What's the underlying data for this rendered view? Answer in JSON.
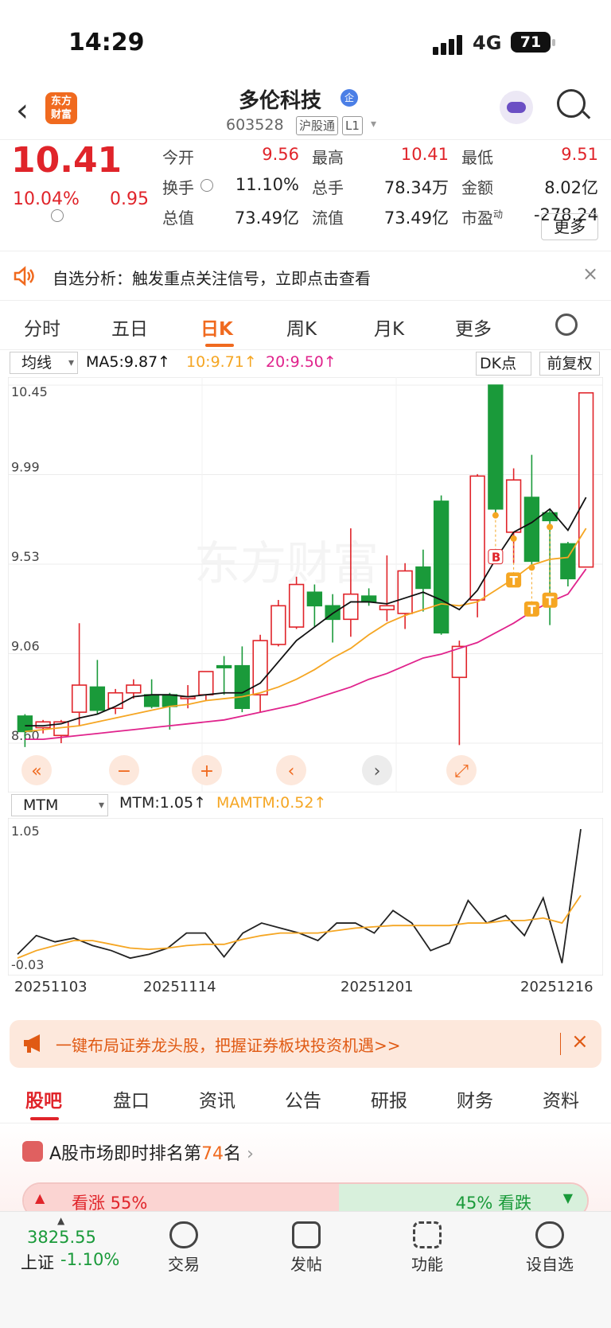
{
  "status_bar": {
    "time": "14:29",
    "network": "4G",
    "battery": "71"
  },
  "header": {
    "logo_line1": "东方",
    "logo_line2": "财富",
    "stock_name": "多伦科技",
    "badge": "企",
    "stock_code": "603528",
    "tag_connect": "沪股通",
    "tag_level": "L1"
  },
  "quote": {
    "price": "10.41",
    "change_pct": "10.04%",
    "change": "0.95",
    "fields": [
      {
        "label": "今开",
        "value": "9.56",
        "color": "red"
      },
      {
        "label": "最高",
        "value": "10.41",
        "color": "red"
      },
      {
        "label": "最低",
        "value": "9.51",
        "color": "red"
      },
      {
        "label": "换手",
        "value": "11.10%",
        "color": "black"
      },
      {
        "label": "总手",
        "value": "78.34万",
        "color": "black"
      },
      {
        "label": "金额",
        "value": "8.02亿",
        "color": "black"
      },
      {
        "label": "总值",
        "value": "73.49亿",
        "color": "black"
      },
      {
        "label": "流值",
        "value": "73.49亿",
        "color": "black"
      },
      {
        "label": "市盈",
        "label_sup": "动",
        "value": "-278.24",
        "color": "black"
      }
    ],
    "more_label": "更多"
  },
  "alert": {
    "text": "自选分析：触发重点关注信号，立即点击查看",
    "close": "×"
  },
  "kline_tabs": {
    "tabs": [
      "分时",
      "五日",
      "日K",
      "周K",
      "月K",
      "更多"
    ],
    "active": "日K"
  },
  "ma_bar": {
    "selector": "均线",
    "ma5": "MA5:9.87↑",
    "ma10": "10:9.71↑",
    "ma20": "20:9.50↑",
    "dk_label": "DK点",
    "adjust_label": "前复权",
    "color_ma5": "#111111",
    "color_ma10": "#f5a623",
    "color_ma20": "#e0238c"
  },
  "chart_data": [
    {
      "type": "candlestick",
      "ylabels": [
        "10.45",
        "9.99",
        "9.53",
        "9.06",
        "8.60"
      ],
      "ylim": [
        8.6,
        10.45
      ],
      "candles": [
        [
          8.74,
          8.66,
          8.75,
          8.58
        ],
        [
          8.68,
          8.71,
          8.72,
          8.65
        ],
        [
          8.64,
          8.71,
          8.72,
          8.6
        ],
        [
          8.76,
          8.9,
          9.22,
          8.69
        ],
        [
          8.89,
          8.77,
          9.03,
          8.75
        ],
        [
          8.78,
          8.86,
          8.88,
          8.75
        ],
        [
          8.86,
          8.9,
          8.93,
          8.83
        ],
        [
          8.85,
          8.79,
          8.93,
          8.78
        ],
        [
          8.85,
          8.79,
          8.86,
          8.67
        ],
        [
          8.83,
          8.84,
          8.9,
          8.78
        ],
        [
          8.85,
          8.97,
          8.97,
          8.82
        ],
        [
          9.0,
          8.99,
          9.05,
          8.85
        ],
        [
          9.0,
          8.78,
          9.1,
          8.76
        ],
        [
          8.85,
          9.13,
          9.16,
          8.76
        ],
        [
          9.11,
          9.31,
          9.34,
          9.1
        ],
        [
          9.2,
          9.42,
          9.46,
          9.19
        ],
        [
          9.38,
          9.31,
          9.42,
          9.2
        ],
        [
          9.31,
          9.24,
          9.37,
          9.12
        ],
        [
          9.24,
          9.37,
          9.71,
          9.15
        ],
        [
          9.36,
          9.33,
          9.4,
          9.31
        ],
        [
          9.29,
          9.31,
          9.57,
          9.23
        ],
        [
          9.27,
          9.49,
          9.53,
          9.19
        ],
        [
          9.51,
          9.4,
          9.6,
          9.28
        ],
        [
          9.85,
          9.17,
          9.88,
          9.16
        ],
        [
          8.94,
          9.1,
          9.13,
          8.59
        ],
        [
          9.34,
          9.98,
          9.99,
          9.25
        ],
        [
          10.45,
          9.81,
          10.45,
          9.79
        ],
        [
          9.69,
          9.96,
          10.02,
          9.53
        ],
        [
          9.87,
          9.54,
          10.09,
          9.52
        ],
        [
          9.79,
          9.75,
          9.81,
          9.21
        ],
        [
          9.63,
          9.45,
          9.64,
          9.41
        ],
        [
          9.51,
          10.41,
          10.41,
          9.51
        ]
      ],
      "ma5": [
        8.69,
        8.69,
        8.7,
        8.73,
        8.75,
        8.79,
        8.84,
        8.85,
        8.85,
        8.84,
        8.85,
        8.86,
        8.86,
        8.91,
        9.02,
        9.13,
        9.2,
        9.27,
        9.33,
        9.33,
        9.32,
        9.35,
        9.38,
        9.34,
        9.29,
        9.39,
        9.55,
        9.69,
        9.74,
        9.81,
        9.7,
        9.87
      ],
      "ma10": [
        8.66,
        8.67,
        8.68,
        8.69,
        8.71,
        8.73,
        8.75,
        8.77,
        8.79,
        8.8,
        8.82,
        8.83,
        8.84,
        8.86,
        8.89,
        8.93,
        8.98,
        9.04,
        9.09,
        9.16,
        9.22,
        9.26,
        9.29,
        9.32,
        9.31,
        9.33,
        9.39,
        9.45,
        9.52,
        9.55,
        9.56,
        9.71
      ],
      "ma20": [
        8.62,
        8.62,
        8.63,
        8.64,
        8.65,
        8.66,
        8.67,
        8.68,
        8.69,
        8.7,
        8.71,
        8.72,
        8.74,
        8.76,
        8.78,
        8.8,
        8.83,
        8.86,
        8.89,
        8.93,
        8.96,
        9.0,
        9.04,
        9.06,
        9.09,
        9.12,
        9.17,
        9.22,
        9.28,
        9.33,
        9.37,
        9.5
      ],
      "markers": [
        {
          "index": 26,
          "label": "B"
        },
        {
          "index": 27,
          "label": "T"
        },
        {
          "index": 28,
          "label": "T"
        },
        {
          "index": 29,
          "label": "T"
        }
      ],
      "watermark": "东方财富",
      "controls": [
        "«",
        "−",
        "+",
        "‹",
        "›",
        "⤢"
      ]
    },
    {
      "type": "line",
      "ylabels": [
        "1.05",
        "-0.03"
      ],
      "ylim": [
        -0.03,
        1.05
      ],
      "series": [
        {
          "name": "MTM",
          "values": [
            0.05,
            0.2,
            0.15,
            0.18,
            0.12,
            0.08,
            0.02,
            0.05,
            0.1,
            0.22,
            0.22,
            0.03,
            0.22,
            0.3,
            0.26,
            0.22,
            0.16,
            0.3,
            0.3,
            0.22,
            0.4,
            0.3,
            0.08,
            0.14,
            0.48,
            0.3,
            0.36,
            0.2,
            0.5,
            -0.02,
            1.05
          ]
        },
        {
          "name": "MAMTM",
          "values": [
            0.02,
            0.08,
            0.12,
            0.16,
            0.16,
            0.13,
            0.1,
            0.09,
            0.1,
            0.12,
            0.13,
            0.13,
            0.17,
            0.2,
            0.22,
            0.22,
            0.22,
            0.24,
            0.26,
            0.27,
            0.28,
            0.28,
            0.28,
            0.28,
            0.3,
            0.3,
            0.32,
            0.32,
            0.34,
            0.3,
            0.52
          ]
        }
      ],
      "selector": "MTM",
      "mtm_label": "MTM:1.05↑",
      "mamtm_label": "MAMTM:0.52↑"
    }
  ],
  "dates": [
    "20251103",
    "20251114",
    "20251201",
    "20251216"
  ],
  "banner": {
    "text": "一键布局证券龙头股，把握证券板块投资机遇>>",
    "close": "×"
  },
  "bottom_tabs": {
    "tabs": [
      "股吧",
      "盘口",
      "资讯",
      "公告",
      "研报",
      "财务",
      "资料"
    ],
    "active": "股吧"
  },
  "rank": {
    "prefix": "A股市场即时排名第",
    "num": "74",
    "suffix": "名",
    "up_label": "看涨 55%",
    "down_label": "45% 看跌"
  },
  "dock": {
    "index_value": "3825.55",
    "index_name": "上证",
    "index_pct": "-1.10%",
    "items": [
      "交易",
      "发帖",
      "功能",
      "设自选"
    ]
  }
}
